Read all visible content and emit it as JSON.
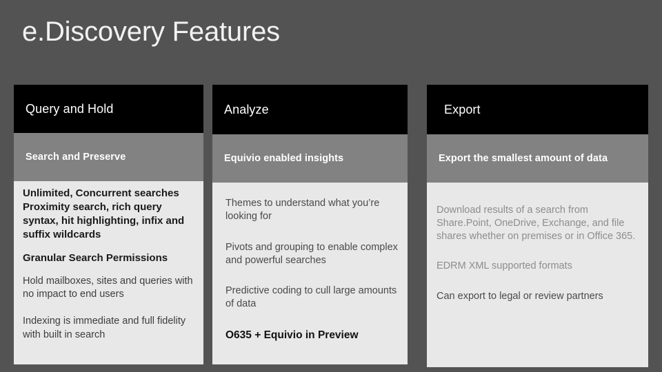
{
  "slide": {
    "title": "e.Discovery Features",
    "background_color": "#535353"
  },
  "colors": {
    "background": "#535353",
    "header_black": "#000000",
    "subheader_gray": "#828282",
    "body_light": "#e8e8e8",
    "title_text": "#f2f2f2",
    "muted_text": "#8d8d8d",
    "dark_text": "#1a1a1a"
  },
  "columns": [
    {
      "header": "Query and Hold",
      "subheader": "Search and Preserve",
      "paragraphs": [
        {
          "style": "bold-dark",
          "text": "Unlimited, Concurrent searches Proximity search, rich query syntax, hit highlighting, infix and suffix wildcards"
        },
        {
          "style": "bold-dark",
          "text": "Granular Search Permissions"
        },
        {
          "style": "light-dark",
          "text": "Hold mailboxes, sites and queries with no impact to end users"
        },
        {
          "style": "light-dark",
          "text": "Indexing is immediate and full fidelity with built in search"
        }
      ]
    },
    {
      "header": "Analyze",
      "subheader": "Equivio enabled insights",
      "paragraphs": [
        {
          "style": "light-dark",
          "text": "Themes to understand what you’re looking for"
        },
        {
          "style": "light-dark",
          "text": "Pivots and grouping to enable complex and powerful searches"
        },
        {
          "style": "light-dark",
          "text": "Predictive coding to cull large amounts of data"
        },
        {
          "style": "bold-dark",
          "text": "O635 + Equivio in Preview"
        }
      ]
    },
    {
      "header": "Export",
      "subheader": "Export the smallest amount of data",
      "paragraphs": [
        {
          "style": "muted",
          "text": "Download results of a search from Share.Point, OneDrive, Exchange, and file shares whether on premises or in Office 365."
        },
        {
          "style": "muted",
          "text": "EDRM XML supported formats"
        },
        {
          "style": "light-dark",
          "text": "Can export to legal or review partners"
        }
      ]
    }
  ]
}
